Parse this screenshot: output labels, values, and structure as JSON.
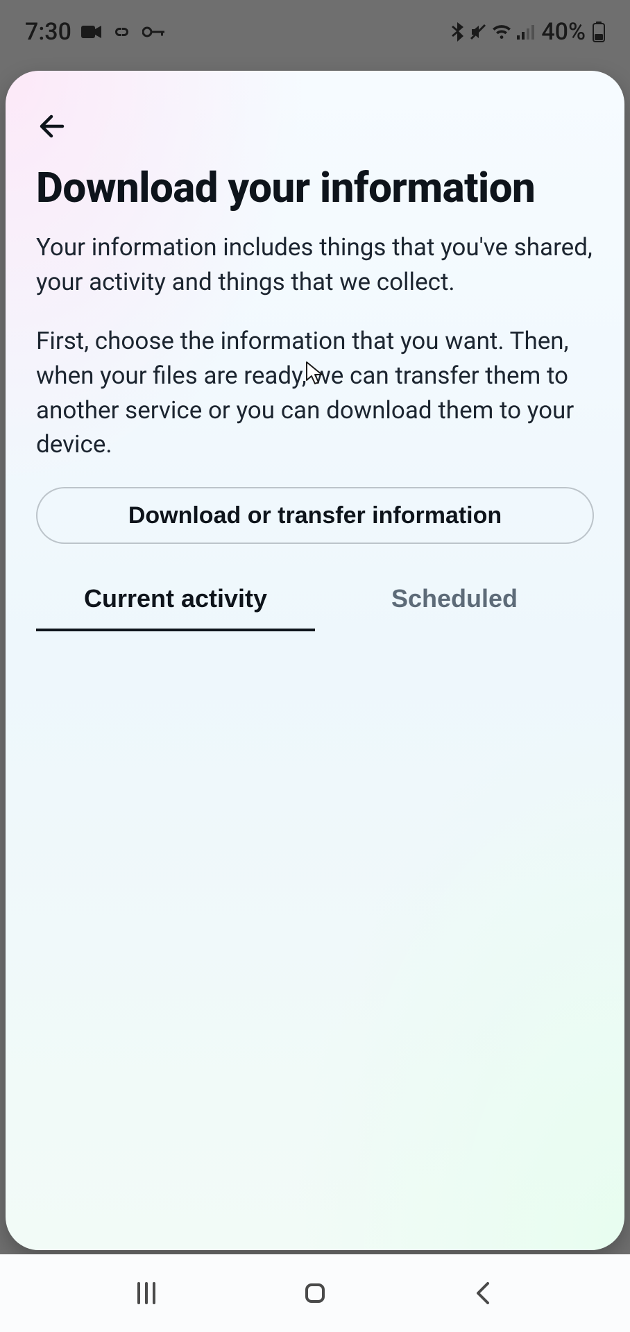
{
  "status": {
    "time": "7:30",
    "battery_text": "40%"
  },
  "page": {
    "title": "Download your information",
    "paragraph1": "Your information includes things that you've shared, your activity and things that we collect.",
    "paragraph2": "First, choose the information that you want. Then, when your files are ready, we can transfer them to another service or you can download them to your device.",
    "download_button_label": "Download or transfer information"
  },
  "tabs": {
    "current_activity": "Current activity",
    "scheduled": "Scheduled",
    "active": "current_activity"
  }
}
